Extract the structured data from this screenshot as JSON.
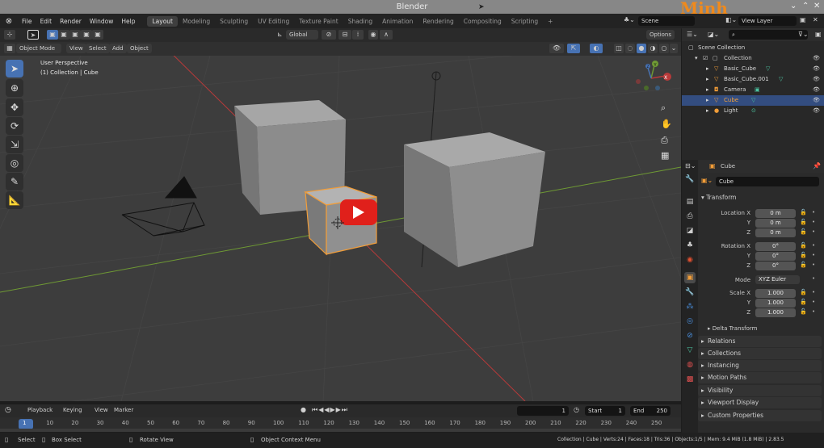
{
  "window": {
    "title": "Blender"
  },
  "watermark": "Minh",
  "menu": [
    "File",
    "Edit",
    "Render",
    "Window",
    "Help"
  ],
  "workspace_tabs": [
    "Layout",
    "Modeling",
    "Sculpting",
    "UV Editing",
    "Texture Paint",
    "Shading",
    "Animation",
    "Rendering",
    "Compositing",
    "Scripting"
  ],
  "workspace_add": "+",
  "scene": "Scene",
  "view_layer": "View Layer",
  "tool_header": {
    "orientation": "Global",
    "options": "Options"
  },
  "viewport_header": {
    "mode": "Object Mode",
    "menus": [
      "View",
      "Select",
      "Add",
      "Object"
    ]
  },
  "viewport_overlay": {
    "line1": "User Perspective",
    "line2": "(1) Collection | Cube"
  },
  "gizmo": {
    "x": "X",
    "y": "Y",
    "z": "Z"
  },
  "timeline": {
    "menus": [
      "Playback",
      "Keying",
      "View",
      "Marker"
    ],
    "current_frame": "1",
    "start_label": "Start",
    "start": "1",
    "end_label": "End",
    "end": "250",
    "ticks": [
      "1",
      "10",
      "20",
      "30",
      "40",
      "50",
      "60",
      "70",
      "80",
      "90",
      "100",
      "110",
      "120",
      "130",
      "140",
      "150",
      "160",
      "170",
      "180",
      "190",
      "200",
      "210",
      "220",
      "230",
      "240",
      "250"
    ]
  },
  "statusbar": {
    "select": "Select",
    "box_select": "Box Select",
    "rotate_view": "Rotate View",
    "context_menu": "Object Context Menu",
    "stats": "Collection | Cube | Verts:24 | Faces:18 | Tris:36 | Objects:1/5 | Mem: 9.4 MiB (1.8 MiB) | 2.83.5"
  },
  "outliner": {
    "scene_collection": "Scene Collection",
    "collection": "Collection",
    "items": [
      {
        "name": "Basic_Cube",
        "icon": "mesh-icon"
      },
      {
        "name": "Basic_Cube.001",
        "icon": "mesh-icon"
      },
      {
        "name": "Camera",
        "icon": "camera-icon"
      },
      {
        "name": "Cube",
        "icon": "mesh-icon",
        "selected": true
      },
      {
        "name": "Light",
        "icon": "light-icon"
      }
    ]
  },
  "properties": {
    "object_name": "Cube",
    "data_name": "Cube",
    "transform": "Transform",
    "location_x_label": "Location X",
    "rotation_x_label": "Rotation X",
    "scale_x_label": "Scale X",
    "y_label": "Y",
    "z_label": "Z",
    "location": [
      "0 m",
      "0 m",
      "0 m"
    ],
    "rotation": [
      "0°",
      "0°",
      "0°"
    ],
    "mode_label": "Mode",
    "mode": "XYZ Euler",
    "scale": [
      "1.000",
      "1.000",
      "1.000"
    ],
    "delta_transform": "Delta Transform",
    "panels": [
      "Relations",
      "Collections",
      "Instancing",
      "Motion Paths",
      "Visibility",
      "Viewport Display",
      "Custom Properties"
    ]
  },
  "colors": {
    "accent_blue": "#4772b3",
    "selection_orange": "#f29d38",
    "x_axis_red": "#b93a3a",
    "y_axis_green": "#6f9a34",
    "youtube_red": "#e0201b"
  }
}
